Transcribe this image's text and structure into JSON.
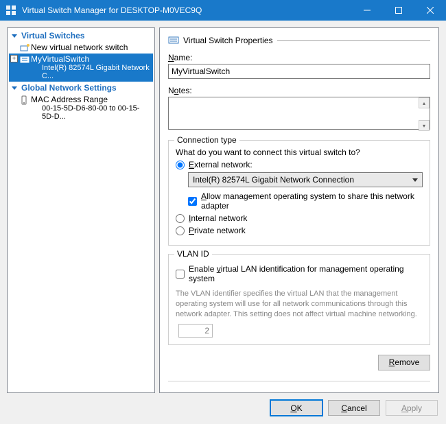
{
  "window": {
    "title": "Virtual Switch Manager for DESKTOP-M0VEC9Q"
  },
  "sidebar": {
    "group_switches": "Virtual Switches",
    "new_switch": "New virtual network switch",
    "selected_switch_name": "MyVirtualSwitch",
    "selected_switch_adapter": "Intel(R) 82574L Gigabit Network C...",
    "group_global": "Global Network Settings",
    "mac_range_label": "MAC Address Range",
    "mac_range_value": "00-15-5D-D6-80-00 to 00-15-5D-D..."
  },
  "props": {
    "header": "Virtual Switch Properties",
    "name_label": "Name:",
    "name_value": "MyVirtualSwitch",
    "notes_label": "Notes:",
    "notes_value": ""
  },
  "connection": {
    "legend": "Connection type",
    "question": "What do you want to connect this virtual switch to?",
    "external_label": "External network:",
    "adapter": "Intel(R) 82574L Gigabit Network Connection",
    "allow_mgmt": "Allow management operating system to share this network adapter",
    "internal_label": "Internal network",
    "private_label": "Private network"
  },
  "vlan": {
    "legend": "VLAN ID",
    "enable_label": "Enable virtual LAN identification for management operating system",
    "desc": "The VLAN identifier specifies the virtual LAN that the management operating system will use for all network communications through this network adapter. This setting does not affect virtual machine networking.",
    "value": "2"
  },
  "buttons": {
    "remove": "Remove",
    "ok": "OK",
    "cancel": "Cancel",
    "apply": "Apply"
  }
}
